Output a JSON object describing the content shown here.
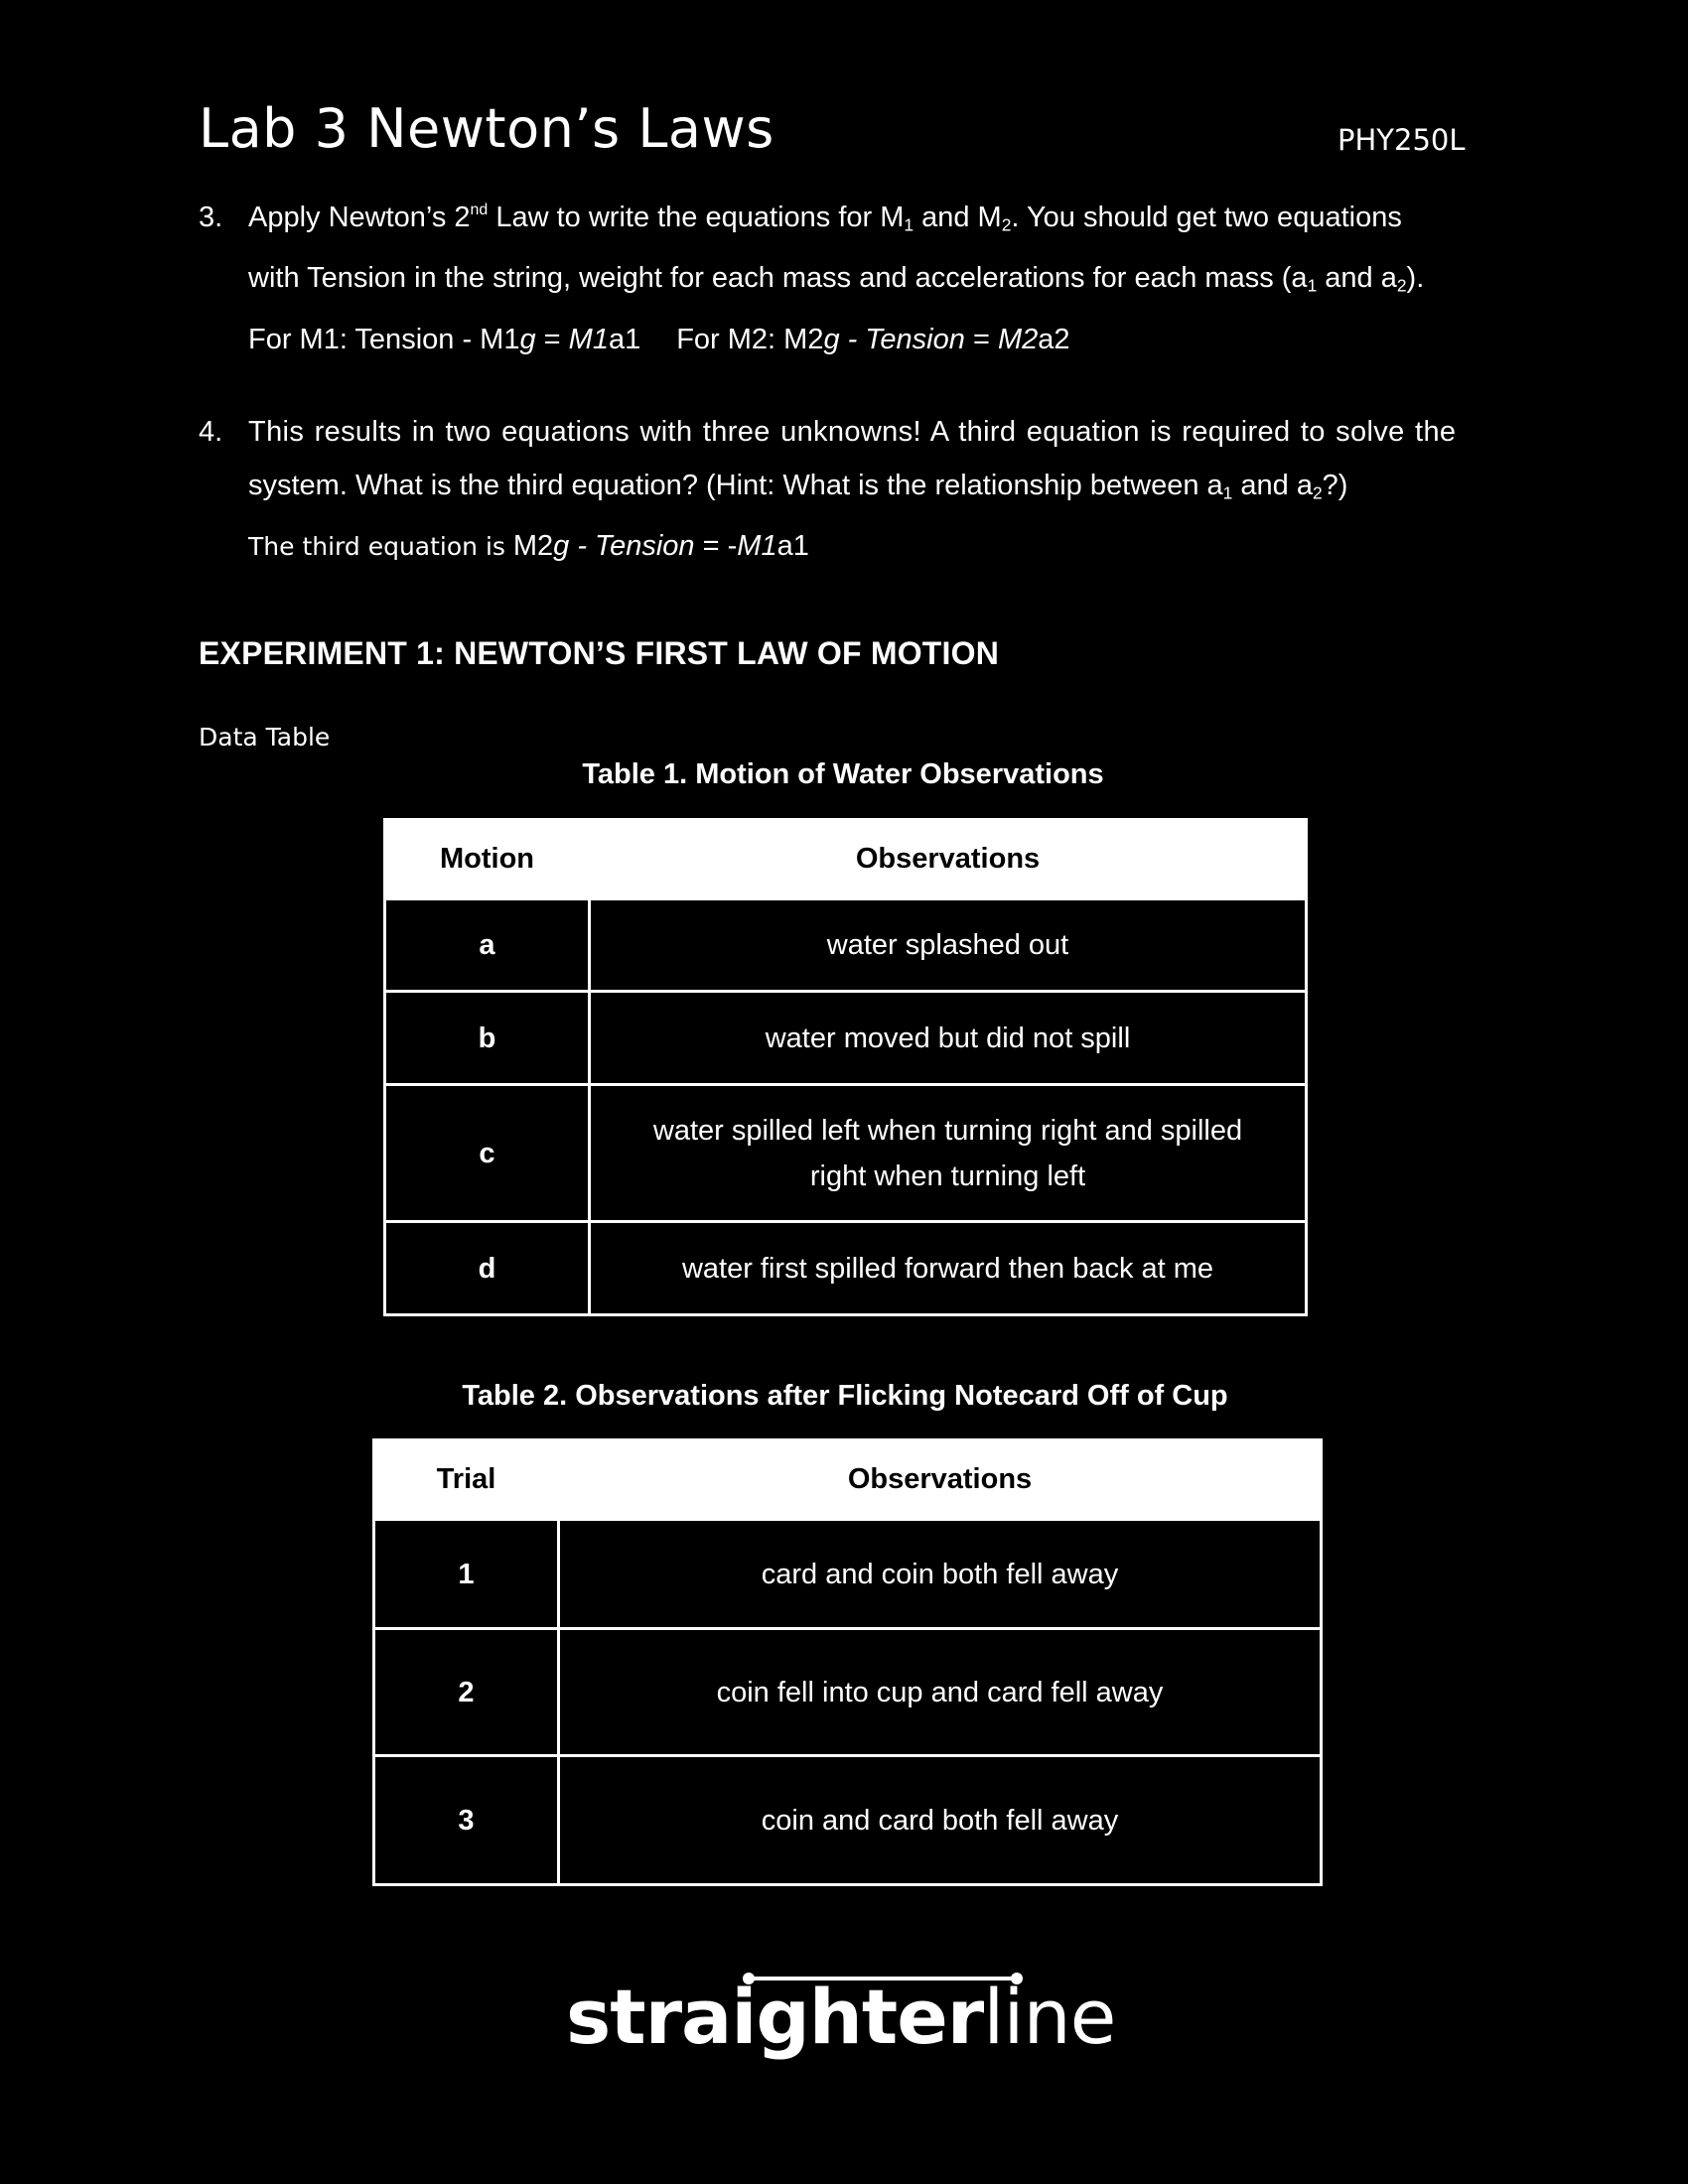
{
  "header": {
    "title": "Lab 3 Newton’s Laws",
    "course": "PHY250L"
  },
  "question3": {
    "number": "3.",
    "l1_a": "Apply Newton’s 2",
    "l1_sup": "nd",
    "l1_b": " Law to write the equations for M",
    "l1_sub1": "1",
    "l1_c": " and M",
    "l1_sub2": "2",
    "l1_d": ". You should get two equations",
    "l2_a": "with Tension in the string, weight for each mass and accelerations for each mass (a",
    "l2_sub1": "1",
    "l2_b": " and a",
    "l2_sub2": "2",
    "l2_c": ").",
    "answer_m1": "For M1: Tension - M1",
    "answer_m1_g": "g",
    "answer_m1_eq": " = ",
    "answer_m1_rhs": "M1",
    "answer_m1_a": "a1",
    "answer_m2": "For M2: M2",
    "answer_m2_g": "g - Tension",
    "answer_m2_eq": " = ",
    "answer_m2_rhs": "M2",
    "answer_m2_a": "a2"
  },
  "question4": {
    "number": "4.",
    "l1": "This results in two equations with three unknowns! A third equation is required to solve the",
    "l2_a": "system.  What is the third equation? (Hint: What is the relationship between a",
    "l2_sub1": "1",
    "l2_b": " and a",
    "l2_sub2": "2",
    "l2_c": "?)",
    "answer_prefix": "The third equation is ",
    "answer_a": "M2",
    "answer_b": "g - Tension",
    "answer_c": " = -",
    "answer_d": "M1",
    "answer_e": "a1"
  },
  "section": {
    "heading": "EXPERIMENT 1: NEWTON’S FIRST LAW OF MOTION",
    "data_table_label": "Data Table"
  },
  "table1": {
    "caption": "Table 1. Motion of Water Observations",
    "headers": [
      "Motion",
      "Observations"
    ],
    "rows": [
      {
        "key": "a",
        "value": "water splashed out"
      },
      {
        "key": "b",
        "value": "water moved but did not spill"
      },
      {
        "key": "c",
        "value": "water spilled left when turning right and spilled right when turning left"
      },
      {
        "key": "d",
        "value": "water first spilled forward then back at me"
      }
    ]
  },
  "table2": {
    "caption": "Table 2. Observations after Flicking Notecard Off of Cup",
    "headers": [
      "Trial",
      "Observations"
    ],
    "rows": [
      {
        "key": "1",
        "value": "card and coin both fell away"
      },
      {
        "key": "2",
        "value": "coin fell into cup and card fell away"
      },
      {
        "key": "3",
        "value": "coin and card both fell away"
      }
    ]
  },
  "logo": {
    "text_bold": "straighter",
    "text_light": "line"
  }
}
